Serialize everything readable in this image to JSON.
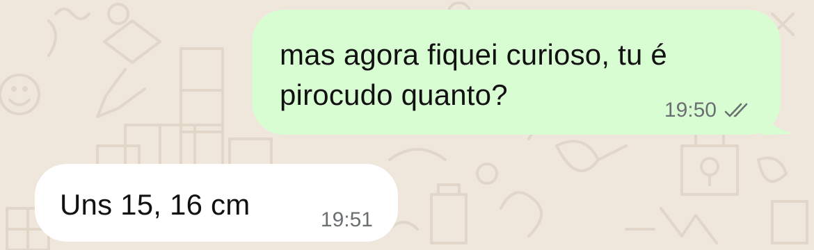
{
  "messages": [
    {
      "direction": "outgoing",
      "lines": [
        "mas agora fiquei curioso, tu é",
        "pirocudo quanto?"
      ],
      "time": "19:50",
      "status_icon": "double-check-read-icon"
    },
    {
      "direction": "incoming",
      "lines": [
        "Uns 15, 16 cm"
      ],
      "time": "19:51"
    }
  ],
  "colors": {
    "background": "#efe7dc",
    "outgoing_bubble": "#d9fdd3",
    "incoming_bubble": "#ffffff",
    "text": "#111111",
    "meta": "#6a6f72",
    "doodle": "#e1d6c8"
  }
}
